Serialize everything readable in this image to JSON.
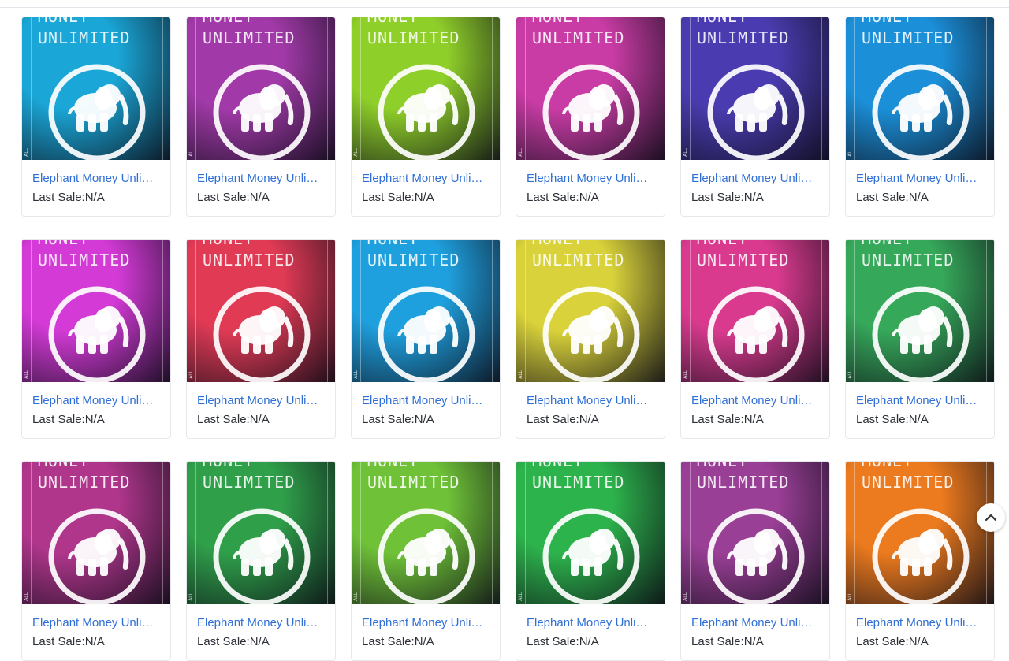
{
  "items": [
    {
      "title": "Elephant Money Unlimited",
      "last_sale": "Last Sale:N/A",
      "color": "#1aa6d6"
    },
    {
      "title": "Elephant Money Unlimited",
      "last_sale": "Last Sale:N/A",
      "color": "#a13aa8"
    },
    {
      "title": "Elephant Money Unlimited",
      "last_sale": "Last Sale:N/A",
      "color": "#8fcf2a"
    },
    {
      "title": "Elephant Money Unlimited",
      "last_sale": "Last Sale:N/A",
      "color": "#c93ca5"
    },
    {
      "title": "Elephant Money Unlimited",
      "last_sale": "Last Sale:N/A",
      "color": "#4a3cb0"
    },
    {
      "title": "Elephant Money Unlimited",
      "last_sale": "Last Sale:N/A",
      "color": "#1b8fd8"
    },
    {
      "title": "Elephant Money Unlimited",
      "last_sale": "Last Sale:N/A",
      "color": "#d33ad6"
    },
    {
      "title": "Elephant Money Unlimited",
      "last_sale": "Last Sale:N/A",
      "color": "#e03a55"
    },
    {
      "title": "Elephant Money Unlimited",
      "last_sale": "Last Sale:N/A",
      "color": "#1fa0de"
    },
    {
      "title": "Elephant Money Unlimited",
      "last_sale": "Last Sale:N/A",
      "color": "#d9d23a"
    },
    {
      "title": "Elephant Money Unlimited",
      "last_sale": "Last Sale:N/A",
      "color": "#d93a8e"
    },
    {
      "title": "Elephant Money Unlimited",
      "last_sale": "Last Sale:N/A",
      "color": "#36a85a"
    },
    {
      "title": "Elephant Money Unlimited",
      "last_sale": "Last Sale:N/A",
      "color": "#b0368c"
    },
    {
      "title": "Elephant Money Unlimited",
      "last_sale": "Last Sale:N/A",
      "color": "#2f9f4a"
    },
    {
      "title": "Elephant Money Unlimited",
      "last_sale": "Last Sale:N/A",
      "color": "#6fc238"
    },
    {
      "title": "Elephant Money Unlimited",
      "last_sale": "Last Sale:N/A",
      "color": "#2db34c"
    },
    {
      "title": "Elephant Money Unlimited",
      "last_sale": "Last Sale:N/A",
      "color": "#9a3f96"
    },
    {
      "title": "Elephant Money Unlimited",
      "last_sale": "Last Sale:N/A",
      "color": "#ec7a1e"
    }
  ],
  "art": {
    "top_word": "MONEY",
    "brand_word": "UNLIMITED",
    "corner_text": "ALL"
  },
  "scroll_top_icon": "chevron-up-icon"
}
